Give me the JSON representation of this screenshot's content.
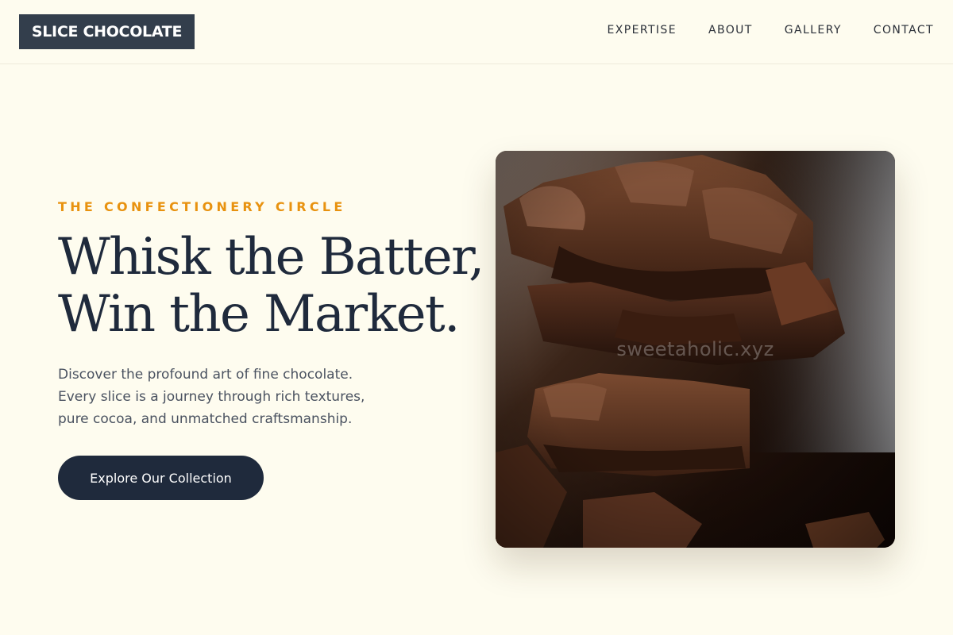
{
  "header": {
    "logo": "SLICE CHOCOLATE",
    "nav": [
      "EXPERTISE",
      "ABOUT",
      "GALLERY",
      "CONTACT"
    ]
  },
  "hero": {
    "eyebrow": "THE CONFECTIONERY CIRCLE",
    "headline_lines": [
      "Whisk the Batter,",
      "Win the Market."
    ],
    "description_lines": [
      "Discover the profound art of fine chocolate.",
      "Every slice is a journey through rich textures,",
      "pure cocoa, and unmatched craftsmanship."
    ],
    "cta_label": "Explore Our Collection",
    "image_watermark": "sweetaholic.xyz"
  },
  "colors": {
    "background": "#fefcef",
    "logo_bg": "#333e4c",
    "accent": "#e8920f",
    "heading": "#1f2a3c",
    "cta_bg": "#1f2a3c"
  },
  "icons": {
    "hero_image": "stacked-chocolate-pieces-photo"
  }
}
